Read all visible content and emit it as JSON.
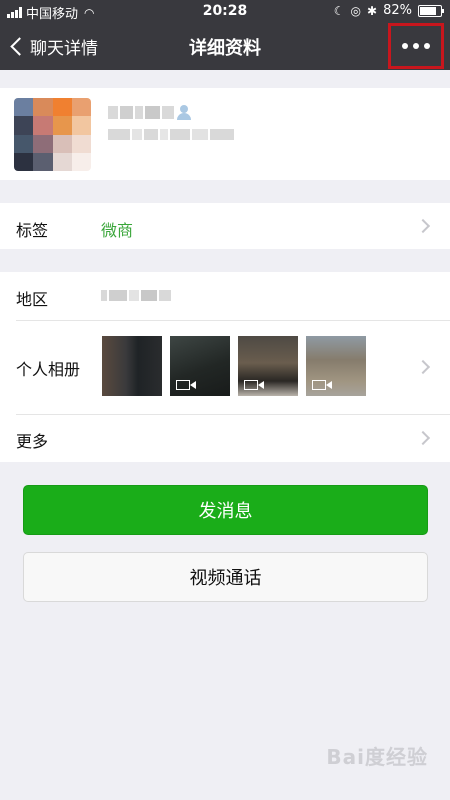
{
  "status_bar": {
    "carrier": "中国移动",
    "time": "20:28",
    "battery": "82%",
    "battery_level": 0.82
  },
  "nav": {
    "back_label": "聊天详情",
    "title": "详细资料"
  },
  "rows": {
    "tag_label": "标签",
    "tag_value": "微商",
    "region_label": "地区",
    "album_label": "个人相册",
    "more_label": "更多"
  },
  "buttons": {
    "send_message": "发消息",
    "video_call": "视频通话"
  },
  "watermark": "Bai度经验",
  "colors": {
    "nav_bg": "#39393e",
    "primary_green": "#1aad19",
    "tag_green": "#3aa63a",
    "highlight_red": "#c8161d"
  }
}
